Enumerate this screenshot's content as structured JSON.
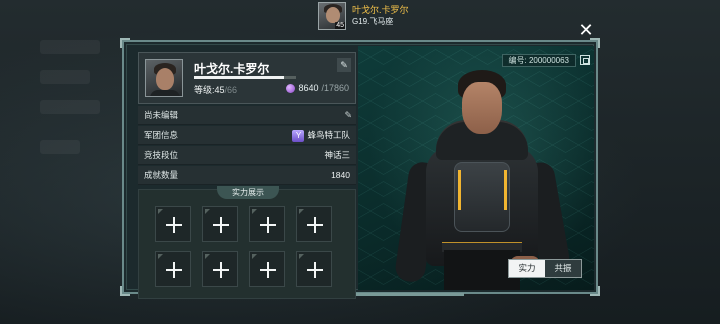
{
  "header": {
    "player_name": "叶戈尔.卡罗尔",
    "player_sub": "G19.飞马座",
    "avatar_level": "45"
  },
  "profile": {
    "name": "叶戈尔.卡罗尔",
    "level_label": "等级:45",
    "level_suffix": "/66",
    "xp_progress": 0.88,
    "gems_current": "8640",
    "gems_max": "/17860",
    "id_label": "编号: 200000063"
  },
  "info_rows": [
    {
      "label": "尚未编辑",
      "value": ""
    },
    {
      "label": "军团信息",
      "value": "蜂鸟特工队",
      "badge": "Y"
    },
    {
      "label": "竞技段位",
      "value": "神话三"
    },
    {
      "label": "成就数量",
      "value": "1840"
    }
  ],
  "power": {
    "title": "实力展示",
    "slot_count": 8
  },
  "toggle": {
    "left": "实力",
    "right": "共振",
    "active": "left"
  },
  "colors": {
    "accent_gold": "#f3c24a",
    "panel_border": "#6a8a8a",
    "showcase_bg": "#0f3c3a"
  },
  "icons": [
    "close-icon",
    "edit-icon",
    "gem-icon",
    "team-badge-icon",
    "copy-icon",
    "plus-icon"
  ]
}
